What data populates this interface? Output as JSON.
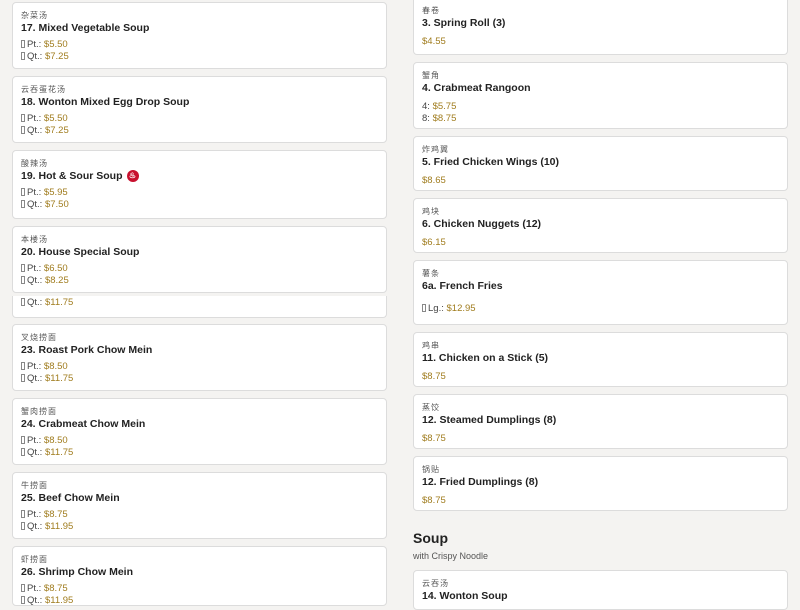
{
  "left": [
    {
      "cn": "杂菜汤",
      "name": "17. Mixed Vegetable Soup",
      "prices": [
        {
          "label": "Pt.",
          "value": "$5.50"
        },
        {
          "label": "Qt.",
          "value": "$7.25"
        }
      ]
    },
    {
      "cn": "云吞蛋花汤",
      "name": "18. Wonton Mixed Egg Drop Soup",
      "prices": [
        {
          "label": "Pt.",
          "value": "$5.50"
        },
        {
          "label": "Qt.",
          "value": "$7.25"
        }
      ]
    },
    {
      "cn": "酸辣汤",
      "name": "19. Hot & Sour Soup",
      "spicy": true,
      "prices": [
        {
          "label": "Pt.",
          "value": "$5.95"
        },
        {
          "label": "Qt.",
          "value": "$7.50"
        }
      ]
    },
    {
      "cn": "本楼汤",
      "name": "20. House Special Soup",
      "prices": [
        {
          "label": "Pt.",
          "value": "$6.50"
        },
        {
          "label": "Qt.",
          "value": "$8.25"
        }
      ]
    },
    {
      "cn": "叉烧捞面",
      "name": "23. Roast Pork Chow Mein",
      "prices": [
        {
          "label": "Pt.",
          "value": "$8.50"
        },
        {
          "label": "Qt.",
          "value": "$11.75"
        }
      ]
    },
    {
      "cn": "蟹肉捞面",
      "name": "24. Crabmeat Chow Mein",
      "prices": [
        {
          "label": "Pt.",
          "value": "$8.50"
        },
        {
          "label": "Qt.",
          "value": "$11.75"
        }
      ]
    },
    {
      "cn": "牛捞面",
      "name": "25. Beef Chow Mein",
      "prices": [
        {
          "label": "Pt.",
          "value": "$8.75"
        },
        {
          "label": "Qt.",
          "value": "$11.95"
        }
      ]
    },
    {
      "cn": "虾捞面",
      "name": "26. Shrimp Chow Mein",
      "prices": [
        {
          "label": "Pt.",
          "value": "$8.75"
        },
        {
          "label": "Qt.",
          "value": "$11.95"
        }
      ]
    }
  ],
  "left_ghost": {
    "label": "Qt.",
    "value": "$11.75"
  },
  "right": [
    {
      "cn": "春卷",
      "name": "3. Spring Roll (3)",
      "price": "$4.55"
    },
    {
      "cn": "蟹角",
      "name": "4. Crabmeat Rangoon",
      "prices": [
        {
          "label": "4",
          "value": "$5.75"
        },
        {
          "label": "8",
          "value": "$8.75"
        }
      ]
    },
    {
      "cn": "炸鸡翼",
      "name": "5. Fried Chicken Wings (10)",
      "price": "$8.65"
    },
    {
      "cn": "鸡块",
      "name": "6. Chicken Nuggets (12)",
      "price": "$6.15"
    },
    {
      "cn": "薯条",
      "name": "6a. French Fries",
      "prices": [
        {
          "label": "Lg.",
          "value": "$12.95"
        }
      ]
    },
    {
      "cn": "鸡串",
      "name": "11. Chicken on a Stick (5)",
      "price": "$8.75"
    },
    {
      "cn": "蒸饺",
      "name": "12. Steamed Dumplings (8)",
      "price": "$8.75"
    },
    {
      "cn": "锅贴",
      "name": "12. Fried Dumplings (8)",
      "price": "$8.75"
    }
  ],
  "soup_section": {
    "title": "Soup",
    "subtitle": "with Crispy Noodle"
  },
  "soup_item": {
    "cn": "云吞汤",
    "name": "14. Wonton Soup"
  },
  "colors": {
    "price": "#a07c1e",
    "spicy": "#c8102e"
  }
}
